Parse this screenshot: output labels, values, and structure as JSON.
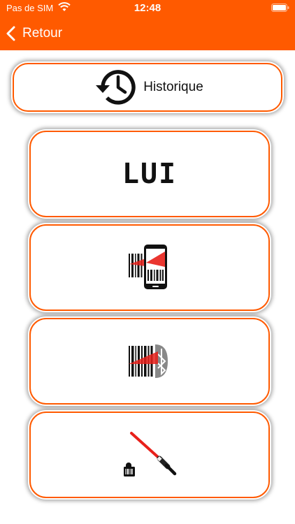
{
  "status": {
    "carrier": "Pas de SIM",
    "time": "12:48"
  },
  "nav": {
    "back_label": "Retour"
  },
  "menu": {
    "history_label": "Historique",
    "lui_label": "LUI"
  },
  "colors": {
    "accent": "#ff5a00",
    "scan_beam": "#e8201a"
  }
}
